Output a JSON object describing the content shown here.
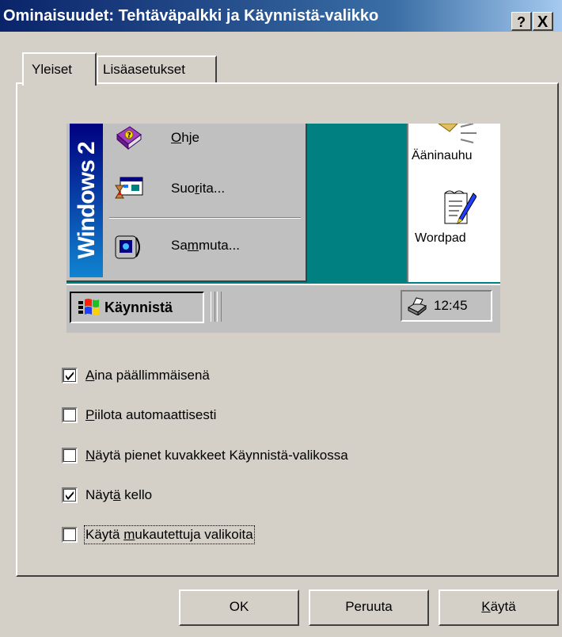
{
  "window": {
    "title": "Ominaisuudet: Tehtäväpalkki ja Käynnistä-valikko",
    "help_label": "?",
    "close_label": "X"
  },
  "tabs": [
    {
      "label": "Yleiset",
      "active": true
    },
    {
      "label": "Lisäasetukset",
      "active": false
    }
  ],
  "preview": {
    "banner_text": "Windows 2",
    "menu_items": [
      {
        "label_pre": "",
        "accel": "O",
        "label_post": "hje",
        "icon": "help-book-icon"
      },
      {
        "label_pre": "Suo",
        "accel": "r",
        "label_post": "ita...",
        "icon": "run-icon"
      },
      {
        "label_pre": "Sa",
        "accel": "m",
        "label_post": "muta...",
        "icon": "shutdown-icon"
      }
    ],
    "desktop_icons": [
      {
        "label": "Ääninauhu",
        "icon": "sound-recorder-icon"
      },
      {
        "label": "Wordpad",
        "icon": "wordpad-icon"
      }
    ],
    "start_label": "Käynnistä",
    "clock": "12:45"
  },
  "options": [
    {
      "label_pre": "",
      "accel": "A",
      "label_post": "ina päällimmäisenä",
      "checked": true
    },
    {
      "label_pre": "",
      "accel": "P",
      "label_post": "iilota automaattisesti",
      "checked": false
    },
    {
      "label_pre": "",
      "accel": "N",
      "label_post": "äytä pienet kuvakkeet Käynnistä-valikossa",
      "checked": false
    },
    {
      "label_pre": "Näyt",
      "accel": "ä",
      "label_post": " kello",
      "checked": true
    },
    {
      "label_pre": "Käytä ",
      "accel": "m",
      "label_post": "ukautettuja valikoita",
      "checked": false
    }
  ],
  "buttons": {
    "ok": "OK",
    "cancel": "Peruuta",
    "apply_pre": "",
    "apply_accel": "K",
    "apply_post": "äytä"
  },
  "colors": {
    "titlebar_start": "#0a246a",
    "desktop": "#008080",
    "face": "#d4d0c8"
  }
}
